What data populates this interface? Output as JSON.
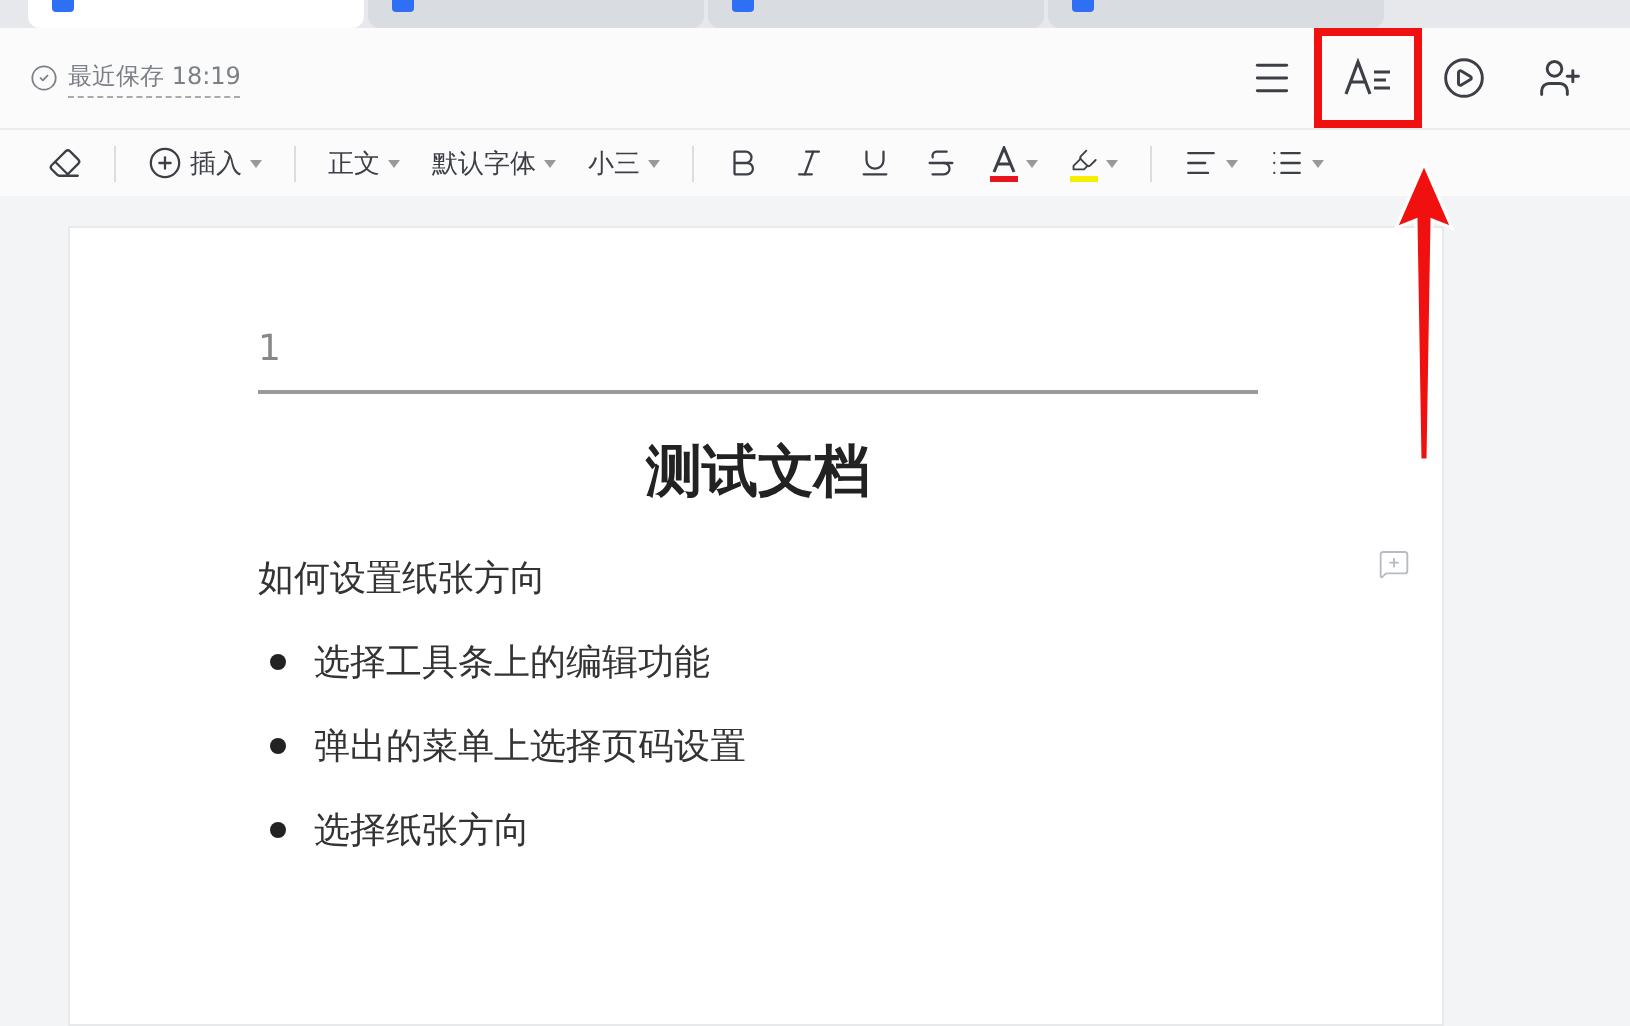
{
  "tabs": [
    {
      "selected": true
    },
    {
      "selected": false
    },
    {
      "selected": false
    },
    {
      "selected": false
    }
  ],
  "save_status": {
    "text": "最近保存 18:19"
  },
  "header_actions": [
    {
      "kind": "menu",
      "highlighted": false
    },
    {
      "kind": "text-style",
      "highlighted": true
    },
    {
      "kind": "play",
      "highlighted": false
    },
    {
      "kind": "add-user",
      "highlighted": false
    }
  ],
  "toolbar": [
    {
      "kind": "eraser",
      "dropdown": false
    },
    {
      "kind": "divider"
    },
    {
      "kind": "insert",
      "label": "插入",
      "dropdown": true
    },
    {
      "kind": "divider"
    },
    {
      "kind": "text",
      "label": "正文",
      "dropdown": true
    },
    {
      "kind": "text",
      "label": "默认字体",
      "dropdown": true
    },
    {
      "kind": "text",
      "label": "小三",
      "dropdown": true
    },
    {
      "kind": "divider"
    },
    {
      "kind": "bold",
      "dropdown": false
    },
    {
      "kind": "italic",
      "dropdown": false
    },
    {
      "kind": "underline",
      "dropdown": false
    },
    {
      "kind": "strike",
      "dropdown": false
    },
    {
      "kind": "font-color",
      "color": "#e8141e",
      "dropdown": true
    },
    {
      "kind": "highlight",
      "color": "#f5ee00",
      "dropdown": true
    },
    {
      "kind": "divider"
    },
    {
      "kind": "align",
      "dropdown": true
    },
    {
      "kind": "list",
      "dropdown": true
    }
  ],
  "document": {
    "header": "1",
    "title": "测试文档",
    "paragraph": "如何设置纸张方向",
    "bullets": [
      "选择工具条上的编辑功能",
      "弹出的菜单上选择页码设置",
      "选择纸张方向"
    ]
  }
}
